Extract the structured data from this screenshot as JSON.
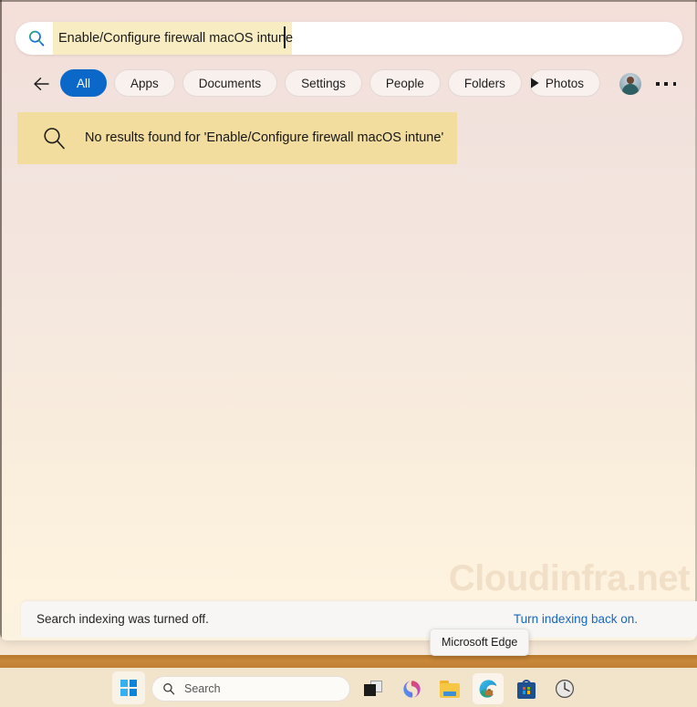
{
  "search": {
    "query": "Enable/Configure firewall macOS intune",
    "icon": "search-icon"
  },
  "tabs": {
    "back_icon": "back-arrow-icon",
    "more_icon": "play-triangle-icon",
    "items": [
      {
        "label": "All",
        "active": true
      },
      {
        "label": "Apps",
        "active": false
      },
      {
        "label": "Documents",
        "active": false
      },
      {
        "label": "Settings",
        "active": false
      },
      {
        "label": "People",
        "active": false
      },
      {
        "label": "Folders",
        "active": false
      },
      {
        "label": "Photos",
        "active": false
      }
    ],
    "avatar": "user-avatar",
    "overflow": "more-options-icon"
  },
  "results": {
    "empty_message": "No results found for 'Enable/Configure firewall macOS intune'",
    "empty_icon": "magnifier-icon",
    "highlight_color": "#f2dd9f"
  },
  "watermark": {
    "text": "Cloudinfra.net"
  },
  "footer": {
    "status": "Search indexing was turned off.",
    "link": "Turn indexing back on.",
    "link_color": "#1668c1"
  },
  "tooltip": {
    "text": "Microsoft Edge"
  },
  "taskbar": {
    "start_label": "start-button",
    "search_placeholder": "Search",
    "items": [
      {
        "name": "task-view",
        "label": "Task View",
        "active": false
      },
      {
        "name": "microsoft-365",
        "label": "Microsoft 365",
        "active": false
      },
      {
        "name": "file-explorer",
        "label": "File Explorer",
        "active": false
      },
      {
        "name": "microsoft-edge",
        "label": "Microsoft Edge",
        "active": true
      },
      {
        "name": "microsoft-store",
        "label": "Microsoft Store",
        "active": false
      },
      {
        "name": "clock",
        "label": "Clock",
        "active": false
      }
    ]
  },
  "theme": {
    "accent_blue": "#0b68c9",
    "highlight_yellow": "#f7ecc2",
    "banner_yellow": "#f2dd9f",
    "taskbar_bg": "#f2e3cb",
    "divider_orange": "#c08034"
  }
}
